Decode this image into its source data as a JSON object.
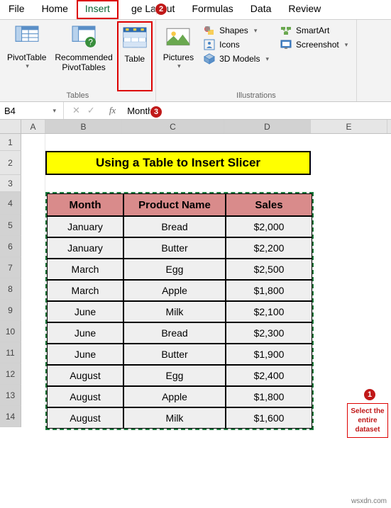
{
  "tabs": [
    "File",
    "Home",
    "Insert",
    "",
    "ge Layout",
    "Formulas",
    "Data",
    "Review"
  ],
  "active_tab": 2,
  "ribbon": {
    "tables_group": "Tables",
    "illus_group": "Illustrations",
    "pivottable": "PivotTable",
    "rec_pt": "Recommended\nPivotTables",
    "table": "Table",
    "pictures": "Pictures",
    "shapes": "Shapes",
    "icons": "Icons",
    "models": "3D Models",
    "smartart": "SmartArt",
    "screenshot": "Screenshot"
  },
  "formula_bar": {
    "name": "B4",
    "value": "Month"
  },
  "cols": [
    "A",
    "B",
    "C",
    "D",
    "E"
  ],
  "rows": [
    "1",
    "2",
    "3",
    "4",
    "5",
    "6",
    "7",
    "8",
    "9",
    "10",
    "11",
    "12",
    "13",
    "14"
  ],
  "title": "Using a Table to Insert Slicer",
  "table": {
    "headers": [
      "Month",
      "Product Name",
      "Sales"
    ],
    "rows": [
      [
        "January",
        "Bread",
        "$2,000"
      ],
      [
        "January",
        "Butter",
        "$2,200"
      ],
      [
        "March",
        "Egg",
        "$2,500"
      ],
      [
        "March",
        "Apple",
        "$1,800"
      ],
      [
        "June",
        "Milk",
        "$2,100"
      ],
      [
        "June",
        "Bread",
        "$2,300"
      ],
      [
        "June",
        "Butter",
        "$1,900"
      ],
      [
        "August",
        "Egg",
        "$2,400"
      ],
      [
        "August",
        "Apple",
        "$1,800"
      ],
      [
        "August",
        "Milk",
        "$1,600"
      ]
    ]
  },
  "badges": {
    "b1": "1",
    "b2": "2",
    "b3": "3"
  },
  "annotation": "Select the entire dataset",
  "watermark": "wsxdn.com"
}
